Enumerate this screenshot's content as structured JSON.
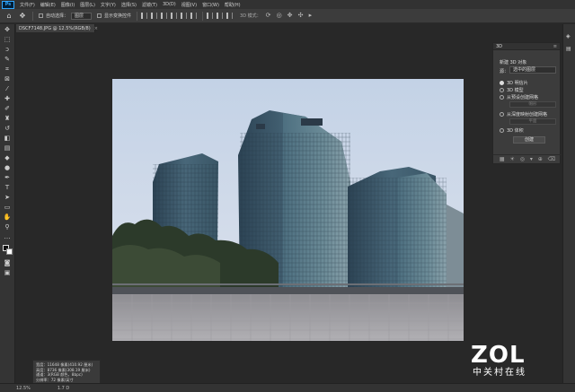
{
  "menu": {
    "app_logo": "Ps",
    "items": [
      "文件(F)",
      "编辑(E)",
      "图像(I)",
      "图层(L)",
      "文字(Y)",
      "选择(S)",
      "滤镜(T)",
      "3D(D)",
      "视图(V)",
      "窗口(W)",
      "帮助(H)"
    ]
  },
  "options": {
    "auto_select_label": "自动选择：",
    "layer_select": "图层",
    "transform_label": "显示变换控件",
    "mode3d_label": "3D 模式："
  },
  "document": {
    "tab_title": "DSCF7148.JPG @ 12.5%(RGB/8)",
    "close_glyph": "×"
  },
  "status": {
    "zoom": "12.5%",
    "coords": "1.7 D"
  },
  "info_box": {
    "line1": "宽度：11648 像素(410.92 厘米)",
    "line2": "高度：8736 像素(308.19 厘米)",
    "line3": "通道：3(RGB 颜色，8bpc)",
    "line4": "分辨率：72 像素/英寸"
  },
  "panel3d": {
    "title": "3D",
    "menu_glyph": "≡",
    "source_label": "源：",
    "new_object_label": "新建 3D 对象",
    "source_select": "选中的图层",
    "options": [
      {
        "label": "3D 明信片",
        "selected": true
      },
      {
        "label": "3D 模型",
        "selected": false
      },
      {
        "label": "从预设创建网格",
        "selected": false
      },
      {
        "label": "从深度映射创建网格",
        "selected": false
      },
      {
        "label": "3D 体积",
        "selected": false
      }
    ],
    "preset_sub": "帽形",
    "depth_sub": "平面",
    "create_button": "创建"
  },
  "watermark": {
    "logo": "ZOL",
    "subtitle": "中关村在线"
  },
  "colors": {
    "accent": "#31a8ff",
    "ui_bg": "#282828",
    "panel_bg": "#3c3c3c"
  }
}
